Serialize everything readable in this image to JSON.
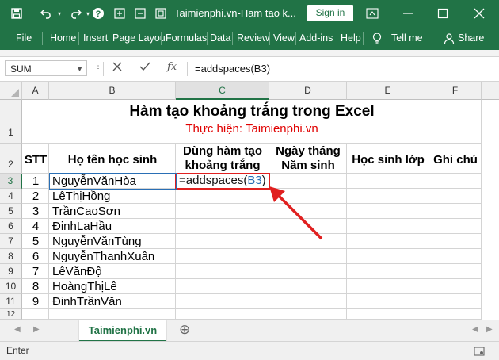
{
  "titlebar": {
    "title": "Taimienphi.vn-Ham tao k...",
    "signin": "Sign in",
    "undo_icon": "undo-icon",
    "redo_icon": "redo-icon",
    "help_icon": "help-icon",
    "restore_icon": "restore-icon",
    "minimize_icon": "minimize-icon",
    "maximize_icon": "maximize-icon",
    "close_icon": "close-icon"
  },
  "ribbon": {
    "tabs": [
      "File",
      "Home",
      "Insert",
      "Page Layou",
      "Formulas",
      "Data",
      "Review",
      "View",
      "Add-ins",
      "Help"
    ],
    "tell_me": "Tell me",
    "share": "Share"
  },
  "formula_bar": {
    "name_box": "SUM",
    "formula": "=addspaces(B3)"
  },
  "columns": [
    "A",
    "B",
    "C",
    "D",
    "E",
    "F"
  ],
  "rows": [
    "1",
    "2",
    "3",
    "4",
    "5",
    "6",
    "7",
    "8",
    "9",
    "10",
    "11",
    "12"
  ],
  "sheet": {
    "title": "Hàm tạo khoảng trắng trong Excel",
    "subtitle": "Thực hiện: Taimienphi.vn",
    "headers": {
      "stt": "STT",
      "name": "Họ tên học sinh",
      "func_line1": "Dùng hàm tạo",
      "func_line2": "khoảng trắng",
      "dob_line1": "Ngày tháng",
      "dob_line2": "Năm sinh",
      "class": "Học sinh lớp",
      "note": "Ghi chú"
    },
    "students": [
      {
        "stt": "1",
        "name": "NguyễnVănHòa"
      },
      {
        "stt": "2",
        "name": "LêThịHồng"
      },
      {
        "stt": "3",
        "name": "TrầnCaoSơn"
      },
      {
        "stt": "4",
        "name": "ĐinhLaHầu"
      },
      {
        "stt": "5",
        "name": "NguyễnVănTùng"
      },
      {
        "stt": "6",
        "name": "NguyễnThanhXuân"
      },
      {
        "stt": "7",
        "name": "LêVănĐộ"
      },
      {
        "stt": "8",
        "name": "HoàngThịLê"
      },
      {
        "stt": "9",
        "name": "ĐinhTrầnVăn"
      }
    ],
    "edit_prefix": "=addspaces(",
    "edit_ref": "B3",
    "edit_suffix": ")"
  },
  "sheet_tab": "Taimienphi.vn",
  "status": "Enter",
  "colors": {
    "excel_green": "#217346",
    "highlight_red": "#e02020",
    "ref_blue": "#2a6fb5"
  }
}
